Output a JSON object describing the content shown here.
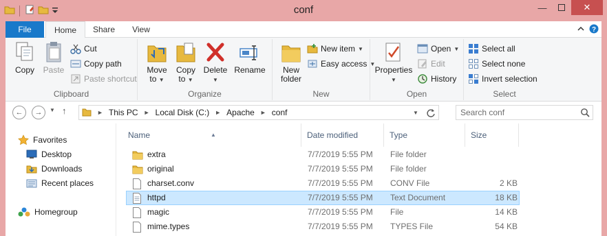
{
  "window": {
    "title": "conf"
  },
  "tabs": {
    "file": "File",
    "home": "Home",
    "share": "Share",
    "view": "View"
  },
  "ribbon": {
    "clipboard": {
      "label": "Clipboard",
      "copy": "Copy",
      "paste": "Paste",
      "cut": "Cut",
      "copy_path": "Copy path",
      "paste_shortcut": "Paste shortcut"
    },
    "organize": {
      "label": "Organize",
      "move_to_1": "Move",
      "move_to_2": "to",
      "copy_to_1": "Copy",
      "copy_to_2": "to",
      "delete": "Delete",
      "rename": "Rename"
    },
    "new": {
      "label": "New",
      "new_folder_1": "New",
      "new_folder_2": "folder",
      "new_item": "New item",
      "easy_access": "Easy access"
    },
    "open": {
      "label": "Open",
      "properties": "Properties",
      "open": "Open",
      "edit": "Edit",
      "history": "History"
    },
    "select": {
      "label": "Select",
      "select_all": "Select all",
      "select_none": "Select none",
      "invert_selection": "Invert selection"
    }
  },
  "address": {
    "crumbs": [
      "This PC",
      "Local Disk (C:)",
      "Apache",
      "conf"
    ],
    "search_placeholder": "Search conf"
  },
  "nav": {
    "favorites": "Favorites",
    "items": [
      "Desktop",
      "Downloads",
      "Recent places"
    ],
    "homegroup": "Homegroup"
  },
  "columns": {
    "name": "Name",
    "date": "Date modified",
    "type": "Type",
    "size": "Size"
  },
  "files": [
    {
      "name": "extra",
      "date": "7/7/2019 5:55 PM",
      "type": "File folder",
      "size": "",
      "kind": "folder"
    },
    {
      "name": "original",
      "date": "7/7/2019 5:55 PM",
      "type": "File folder",
      "size": "",
      "kind": "folder"
    },
    {
      "name": "charset.conv",
      "date": "7/7/2019 5:55 PM",
      "type": "CONV File",
      "size": "2 KB",
      "kind": "file"
    },
    {
      "name": "httpd",
      "date": "7/7/2019 5:55 PM",
      "type": "Text Document",
      "size": "18 KB",
      "kind": "text",
      "selected": true
    },
    {
      "name": "magic",
      "date": "7/7/2019 5:55 PM",
      "type": "File",
      "size": "14 KB",
      "kind": "file"
    },
    {
      "name": "mime.types",
      "date": "7/7/2019 5:55 PM",
      "type": "TYPES File",
      "size": "54 KB",
      "kind": "file"
    }
  ],
  "colors": {
    "file_tab": "#1979ca",
    "title_bg": "#e8a7a7",
    "selection": "#cce8ff",
    "close": "#c75050"
  }
}
